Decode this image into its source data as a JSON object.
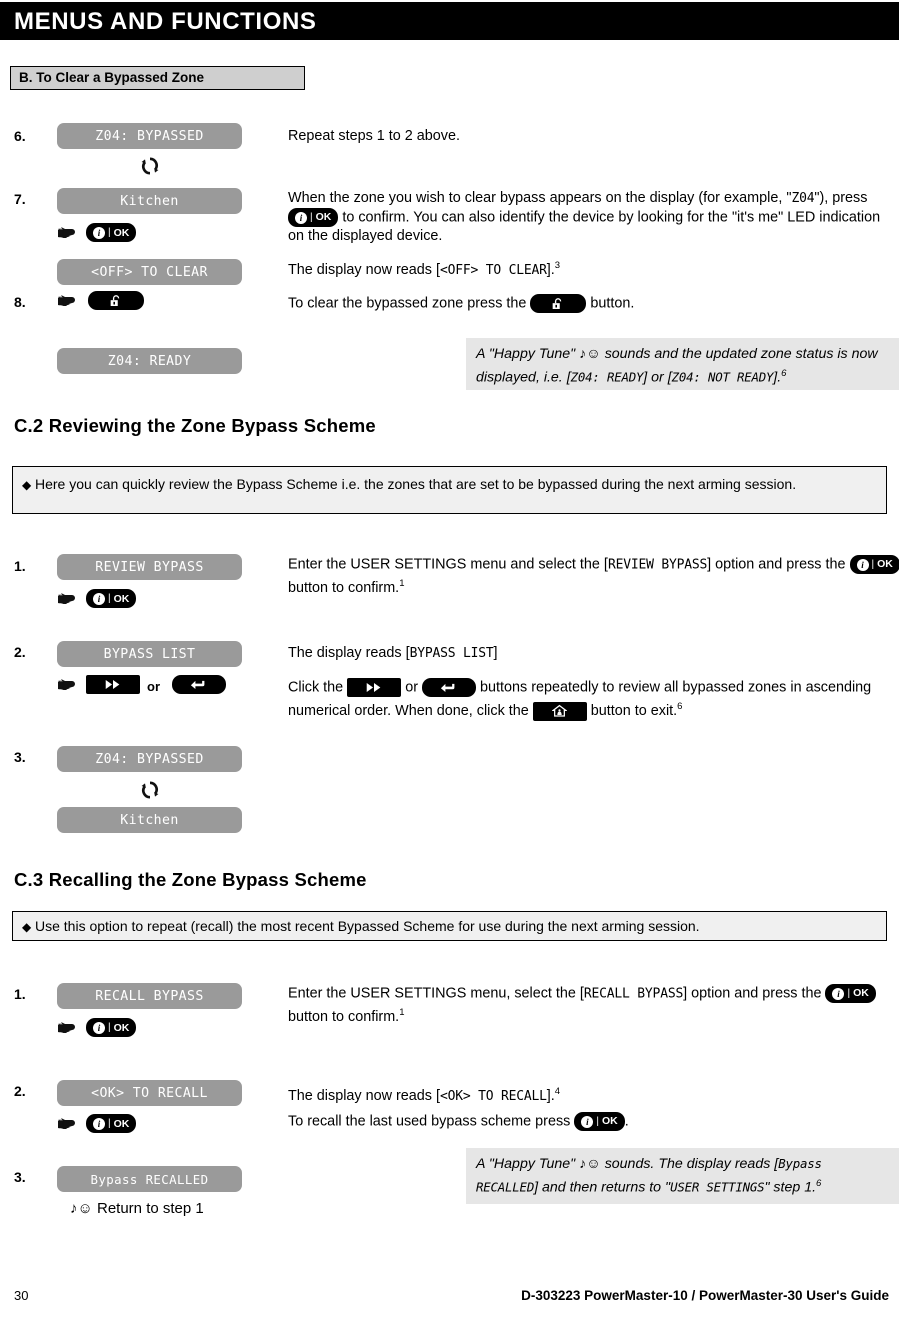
{
  "banner": {
    "title": "MENUS AND FUNCTIONS"
  },
  "subsection": {
    "label": "B. To Clear a Bypassed Zone"
  },
  "colors": {
    "lcd_bg": "#9a9a9a",
    "lcd_text": "#ffffff",
    "button_bg": "#000000",
    "note_bg": "#e6e6e6",
    "bullet_bg": "#f0f0f0",
    "subsec_bg": "#cfcfcf"
  },
  "sectionB": {
    "steps": [
      {
        "num": "6.",
        "lcd": "Z04: BYPASSED",
        "cycle_icon": "cycle-arrows-icon",
        "text": "Repeat steps 1 to 2 above."
      },
      {
        "num": "7.",
        "lcd1": "Kitchen",
        "lcd2": "<OFF> TO CLEAR",
        "hand_icon": "pointing-hand-icon",
        "button": "info-ok-button",
        "text_a": "When the zone you wish to clear bypass appears on the display (for example, \"",
        "text_a_mono": "Z04",
        "text_a2": "\"), press",
        "text_b": "to confirm.  You can also identify the device by looking for the \"it's me\" LED indication on the displayed device.",
        "text_c": "The display now reads [",
        "text_c_mono": "<OFF> TO CLEAR",
        "text_c2": "].",
        "footnote": "3"
      },
      {
        "num": "8.",
        "hand_icon": "pointing-hand-icon",
        "button": "unlock-button",
        "text_a": "To clear the bypassed zone press the",
        "text_b": "button."
      }
    ],
    "result": {
      "lcd": "Z04: READY",
      "note_a": "A \"Happy Tune\"",
      "note_icons": "music-note-smiley-icon",
      "note_b": "sounds and the updated zone status is now displayed, i.e. [",
      "note_mono1": "Z04: READY",
      "note_c": "] or [",
      "note_mono2": "Z04: NOT READY",
      "note_d": "].",
      "footnote": "6"
    }
  },
  "sectionC2": {
    "heading": "C.2 Reviewing the Zone Bypass Scheme",
    "bullet": "Here you can quickly review the Bypass Scheme i.e. the zones that are set to be bypassed during the next arming session.",
    "steps": [
      {
        "num": "1.",
        "lcd": "REVIEW BYPASS",
        "hand_icon": "pointing-hand-icon",
        "button": "info-ok-button",
        "text_a": "Enter the USER SETTINGS menu and select the [",
        "text_a_mono": "REVIEW BYPASS",
        "text_a2": "] option and press the",
        "text_b": "button to confirm.",
        "footnote": "1"
      },
      {
        "num": "2.",
        "lcd": "BYPASS LIST",
        "hand_icon": "pointing-hand-icon",
        "button1": "forward-button",
        "or_label": "or",
        "button2": "back-button",
        "text_a": "The display reads [",
        "text_a_mono": "BYPASS LIST",
        "text_a2": "]",
        "text_b": "Click the",
        "text_c": "or",
        "text_d": "buttons repeatedly to review all bypassed zones in ascending numerical order. When done, click the",
        "text_e": "button to exit.",
        "footnote": "6"
      },
      {
        "num": "3.",
        "lcd1": "Z04: BYPASSED",
        "cycle_icon": "cycle-arrows-icon",
        "lcd2": "Kitchen"
      }
    ]
  },
  "sectionC3": {
    "heading": "C.3 Recalling the Zone Bypass Scheme",
    "bullet": "Use this option to repeat (recall) the most recent Bypassed Scheme for use during the next arming session.",
    "steps": [
      {
        "num": "1.",
        "lcd": "RECALL BYPASS",
        "hand_icon": "pointing-hand-icon",
        "button": "info-ok-button",
        "text_a": "Enter the USER SETTINGS menu, select the [",
        "text_a_mono": "RECALL BYPASS",
        "text_a2": "] option and press the",
        "text_b": "button to confirm.",
        "footnote": "1"
      },
      {
        "num": "2.",
        "lcd": "<OK> TO RECALL",
        "hand_icon": "pointing-hand-icon",
        "button": "info-ok-button",
        "text_a": "The display now reads [",
        "text_a_mono": "<OK> TO RECALL",
        "text_a2": "].",
        "footnote": "4",
        "text_b": "To recall the last used bypass scheme press",
        "text_b2": "."
      },
      {
        "num": "3.",
        "lcd": "Bypass RECALLED",
        "return_label": "Return to step 1",
        "return_icons": "music-note-smiley-icon",
        "note_a": "A \"Happy Tune\"",
        "note_b": "sounds. The display reads [",
        "note_mono1": "Bypass RECALLED",
        "note_c": "] and then returns to \"",
        "note_mono2": "USER SETTINGS",
        "note_d": "\" step 1.",
        "footnote": "6"
      }
    ]
  },
  "footer": {
    "page_number": "30",
    "doc_ref": "D-303223 PowerMaster-10 / PowerMaster-30 User's Guide"
  }
}
